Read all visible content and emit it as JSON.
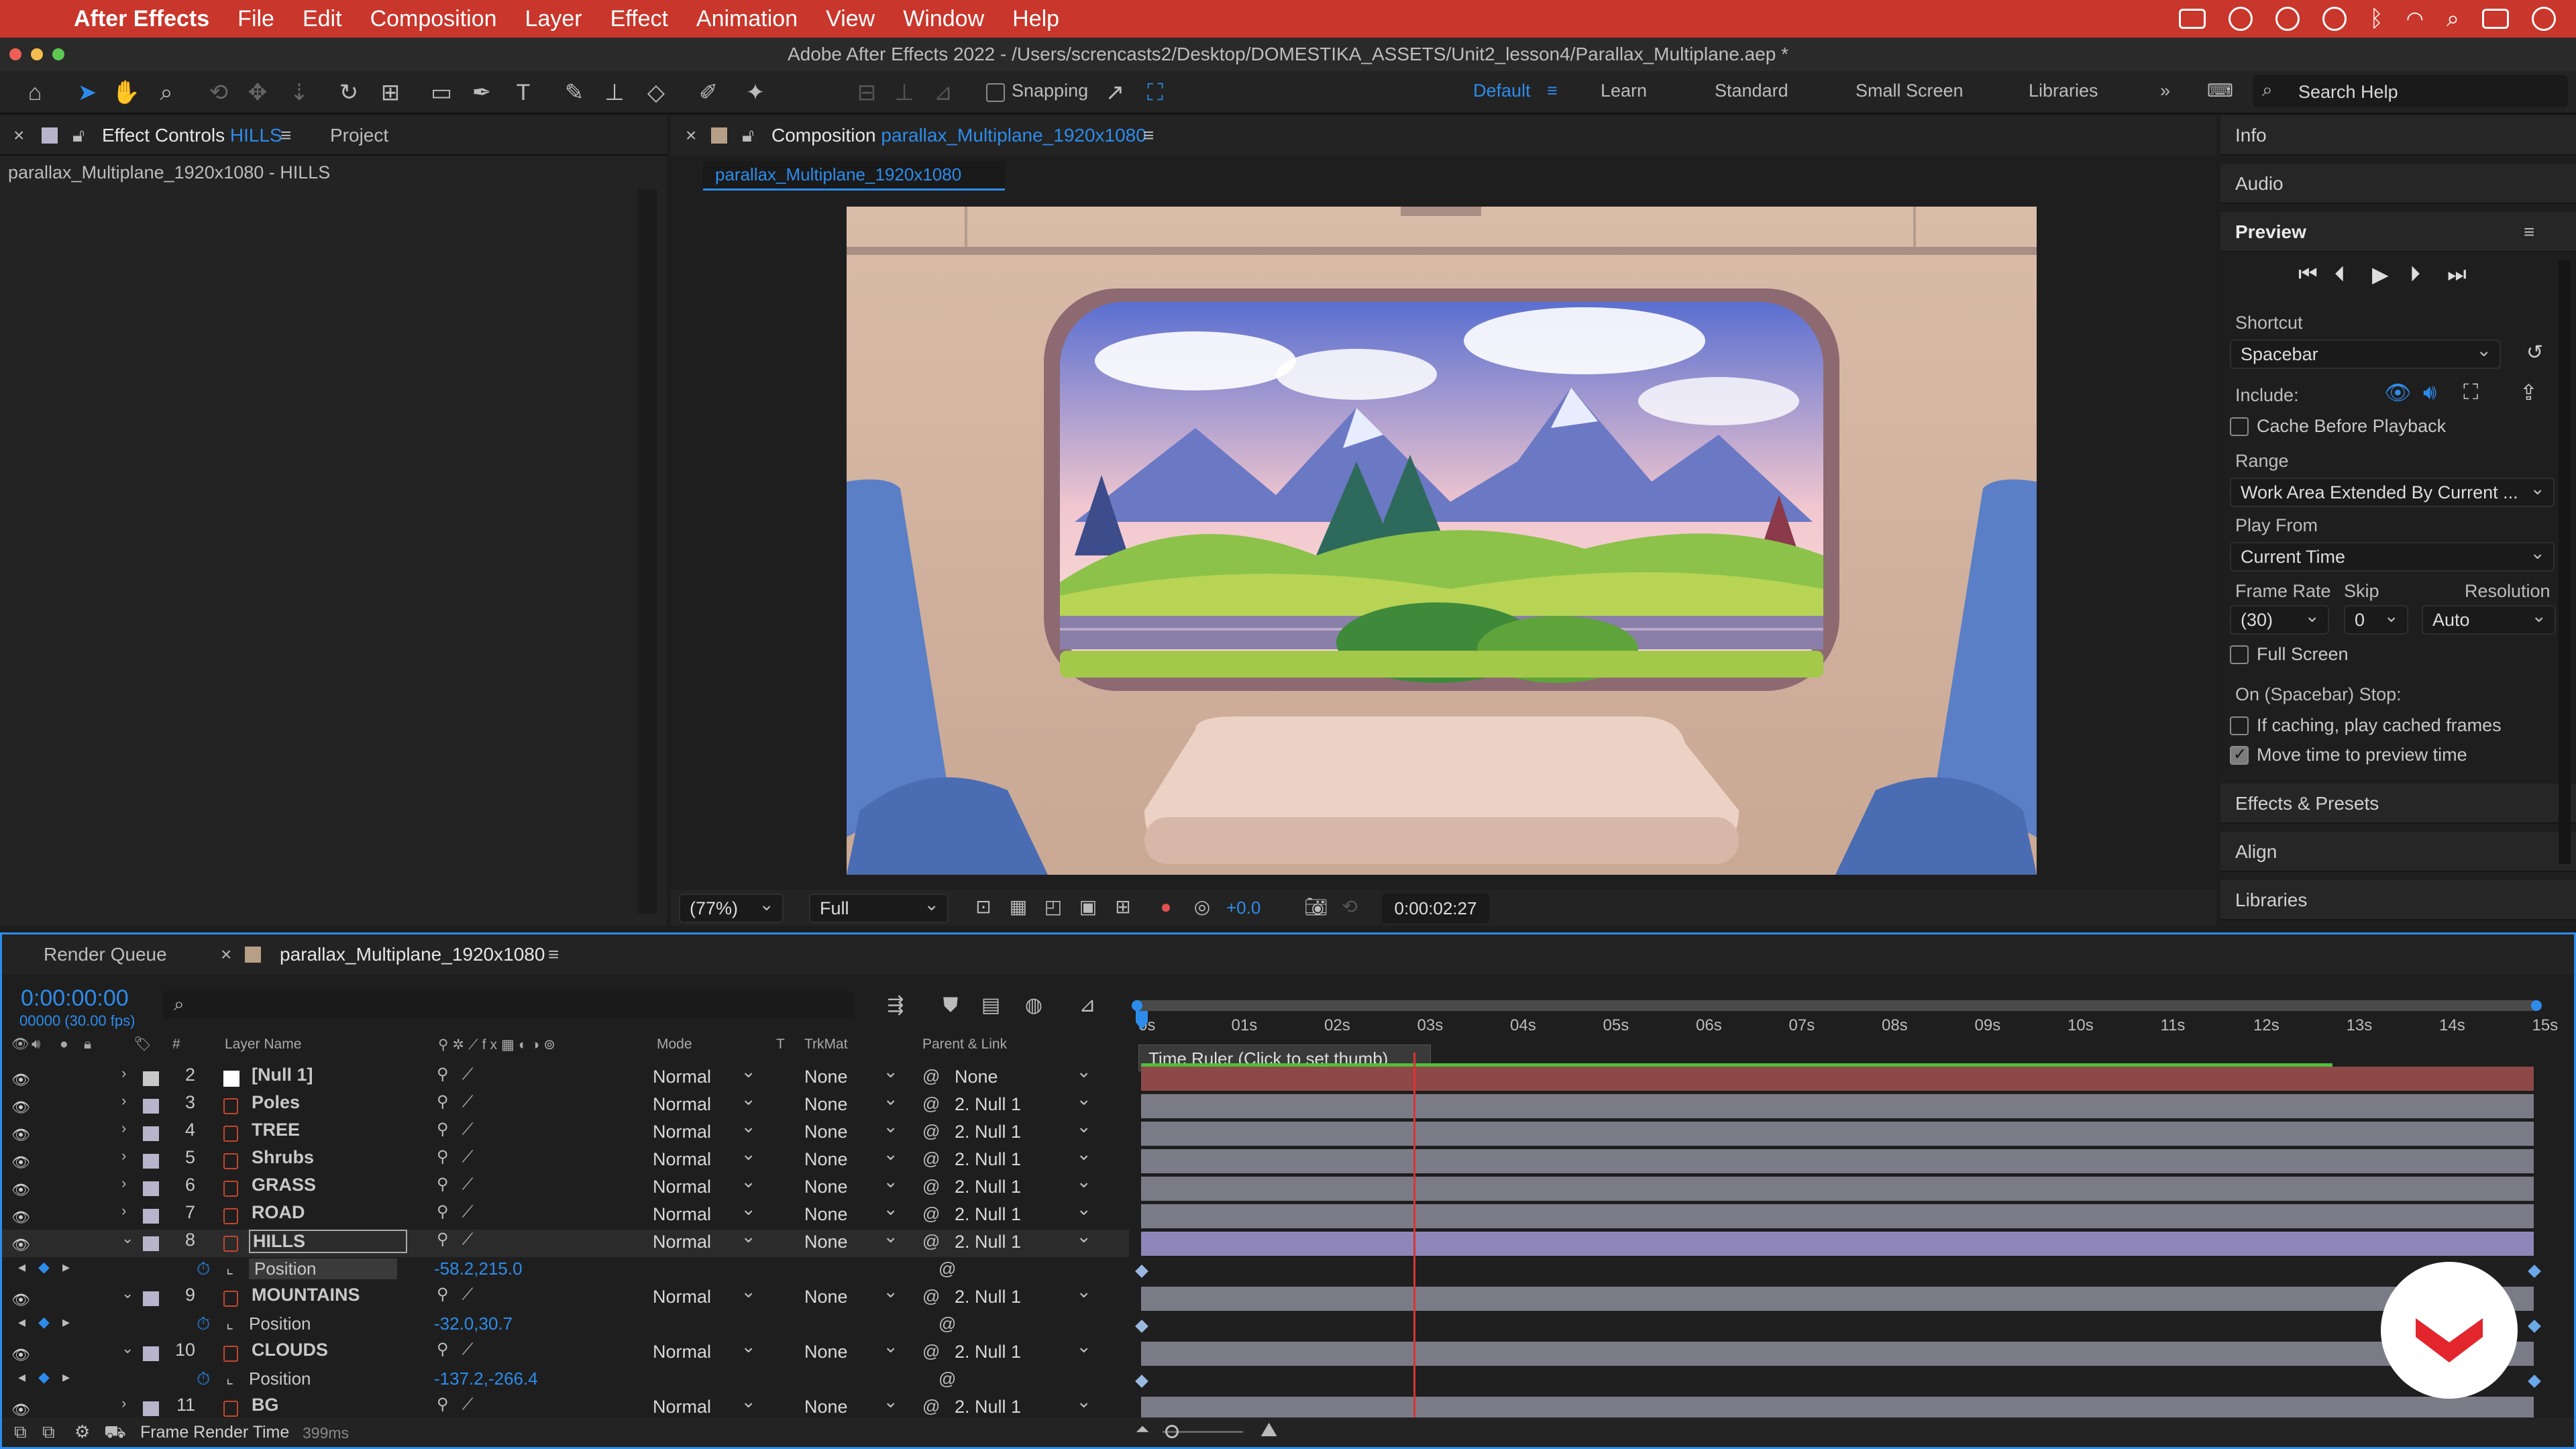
{
  "menubar": {
    "app": "After Effects",
    "items": [
      "File",
      "Edit",
      "Composition",
      "Layer",
      "Effect",
      "Animation",
      "View",
      "Window",
      "Help"
    ]
  },
  "window_title": "Adobe After Effects 2022 - /Users/screncasts2/Desktop/DOMESTIKA_ASSETS/Unit2_lesson4/Parallax_Multiplane.aep *",
  "toolbar": {
    "snapping": "Snapping",
    "workspaces": [
      "Default",
      "Learn",
      "Standard",
      "Small Screen",
      "Libraries"
    ],
    "active_workspace": "Default",
    "search_placeholder": "Search Help"
  },
  "left_panel": {
    "tab_effect_controls": "Effect Controls",
    "tab_effect_layer": "HILLS",
    "tab_project": "Project",
    "breadcrumb": "parallax_Multiplane_1920x1080 - HILLS"
  },
  "comp_panel": {
    "tab_label": "Composition",
    "comp_name": "parallax_Multiplane_1920x1080",
    "sub_tab": "parallax_Multiplane_1920x1080",
    "zoom": "(77%)",
    "resolution": "Full",
    "exposure": "+0.0",
    "timecode": "0:00:02:27"
  },
  "right_panel": {
    "info": "Info",
    "audio": "Audio",
    "preview": "Preview",
    "shortcut_label": "Shortcut",
    "shortcut_value": "Spacebar",
    "include_label": "Include:",
    "cache_label": "Cache Before Playback",
    "range_label": "Range",
    "range_value": "Work Area Extended By Current ...",
    "play_from_label": "Play From",
    "play_from_value": "Current Time",
    "frame_rate_label": "Frame Rate",
    "skip_label": "Skip",
    "resolution_label": "Resolution",
    "frame_rate_value": "(30)",
    "skip_value": "0",
    "resolution_value": "Auto",
    "full_screen_label": "Full Screen",
    "stop_label": "On (Spacebar) Stop:",
    "if_caching_label": "If caching, play cached frames",
    "move_time_label": "Move time to preview time",
    "effects_presets": "Effects & Presets",
    "align": "Align",
    "libraries": "Libraries"
  },
  "timeline": {
    "render_queue_tab": "Render Queue",
    "comp_tab": "parallax_Multiplane_1920x1080",
    "current_time": "0:00:00:00",
    "frame_info": "00000 (30.00 fps)",
    "col_num": "#",
    "col_layer_name": "Layer Name",
    "col_mode": "Mode",
    "col_t": "T",
    "col_trkmat": "TrkMat",
    "col_parent": "Parent & Link",
    "ruler_tooltip": "Time Ruler (Click to set thumb)",
    "ruler_ticks": [
      "0s",
      "01s",
      "02s",
      "03s",
      "04s",
      "05s",
      "06s",
      "07s",
      "08s",
      "09s",
      "10s",
      "11s",
      "12s",
      "13s",
      "14s",
      "15s"
    ],
    "layers": [
      {
        "num": "2",
        "name": "[Null 1]",
        "mode": "Normal",
        "trkmat": "None",
        "parent": "None",
        "color": "#c8c8c8"
      },
      {
        "num": "3",
        "name": "Poles",
        "mode": "Normal",
        "trkmat": "None",
        "parent": "2. Null 1",
        "color": "#b7b4cc"
      },
      {
        "num": "4",
        "name": "TREE",
        "mode": "Normal",
        "trkmat": "None",
        "parent": "2. Null 1",
        "color": "#b7b4cc"
      },
      {
        "num": "5",
        "name": "Shrubs",
        "mode": "Normal",
        "trkmat": "None",
        "parent": "2. Null 1",
        "color": "#b7b4cc"
      },
      {
        "num": "6",
        "name": "GRASS",
        "mode": "Normal",
        "trkmat": "None",
        "parent": "2. Null 1",
        "color": "#b7b4cc"
      },
      {
        "num": "7",
        "name": "ROAD",
        "mode": "Normal",
        "trkmat": "None",
        "parent": "2. Null 1",
        "color": "#b7b4cc"
      },
      {
        "num": "8",
        "name": "HILLS",
        "mode": "Normal",
        "trkmat": "None",
        "parent": "2. Null 1",
        "color": "#b7b4cc"
      },
      {
        "num": "9",
        "name": "MOUNTAINS",
        "mode": "Normal",
        "trkmat": "None",
        "parent": "2. Null 1",
        "color": "#b7b4cc"
      },
      {
        "num": "10",
        "name": "CLOUDS",
        "mode": "Normal",
        "trkmat": "None",
        "parent": "2. Null 1",
        "color": "#b7b4cc"
      },
      {
        "num": "11",
        "name": "BG",
        "mode": "Normal",
        "trkmat": "None",
        "parent": "2. Null 1",
        "color": "#b7b4cc"
      }
    ],
    "position_label": "Position",
    "hills_position": "-58.2,215.0",
    "mountains_position": "-32.0,30.7",
    "clouds_position": "-137.2,-266.4",
    "footer_label": "Frame Render Time",
    "footer_value": "399ms"
  }
}
